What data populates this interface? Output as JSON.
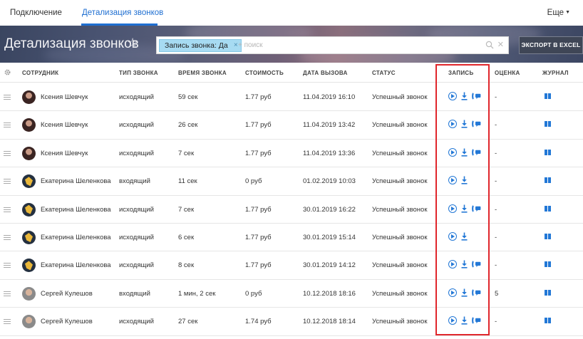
{
  "nav": {
    "tab_connection": "Подключение",
    "tab_details": "Детализация звонков",
    "more": "Еще"
  },
  "banner": {
    "title": "Детализация звонков",
    "chip": "Запись звонка: Да",
    "search_placeholder": "+ поиск",
    "export_label": "ЭКСПОРТ В EXCEL"
  },
  "columns": {
    "employee": "СОТРУДНИК",
    "type": "ТИП ЗВОНКА",
    "time": "ВРЕМЯ ЗВОНКА",
    "cost": "СТОИМОСТЬ",
    "date": "ДАТА ВЫЗОВА",
    "status": "СТАТУС",
    "record": "ЗАПИСЬ",
    "score": "ОЦЕНКА",
    "journal": "ЖУРНАЛ"
  },
  "rows": [
    {
      "name": "Ксения Шевчук",
      "avatar": "k",
      "type": "исходящий",
      "time": "59 сек",
      "cost": "1.77 руб",
      "date": "11.04.2019 16:10",
      "status": "Успешный звонок",
      "call_icon": true,
      "score": "-"
    },
    {
      "name": "Ксения Шевчук",
      "avatar": "k",
      "type": "исходящий",
      "time": "26 сек",
      "cost": "1.77 руб",
      "date": "11.04.2019 13:42",
      "status": "Успешный звонок",
      "call_icon": true,
      "score": "-"
    },
    {
      "name": "Ксения Шевчук",
      "avatar": "k",
      "type": "исходящий",
      "time": "7 сек",
      "cost": "1.77 руб",
      "date": "11.04.2019 13:36",
      "status": "Успешный звонок",
      "call_icon": true,
      "score": "-"
    },
    {
      "name": "Екатерина Шеленкова",
      "avatar": "e",
      "type": "входящий",
      "time": "11 сек",
      "cost": "0 руб",
      "date": "01.02.2019 10:03",
      "status": "Успешный звонок",
      "call_icon": false,
      "score": "-"
    },
    {
      "name": "Екатерина Шеленкова",
      "avatar": "e",
      "type": "исходящий",
      "time": "7 сек",
      "cost": "1.77 руб",
      "date": "30.01.2019 16:22",
      "status": "Успешный звонок",
      "call_icon": true,
      "score": "-"
    },
    {
      "name": "Екатерина Шеленкова",
      "avatar": "e",
      "type": "исходящий",
      "time": "6 сек",
      "cost": "1.77 руб",
      "date": "30.01.2019 15:14",
      "status": "Успешный звонок",
      "call_icon": false,
      "score": "-"
    },
    {
      "name": "Екатерина Шеленкова",
      "avatar": "e",
      "type": "исходящий",
      "time": "8 сек",
      "cost": "1.77 руб",
      "date": "30.01.2019 14:12",
      "status": "Успешный звонок",
      "call_icon": true,
      "score": "-"
    },
    {
      "name": "Сергей Кулешов",
      "avatar": "s",
      "type": "входящий",
      "time": "1 мин, 2 сек",
      "cost": "0 руб",
      "date": "10.12.2018 18:16",
      "status": "Успешный звонок",
      "call_icon": true,
      "score": "5"
    },
    {
      "name": "Сергей Кулешов",
      "avatar": "s",
      "type": "исходящий",
      "time": "27 сек",
      "cost": "1.74 руб",
      "date": "10.12.2018 18:14",
      "status": "Успешный звонок",
      "call_icon": true,
      "score": "-"
    }
  ],
  "colors": {
    "accent": "#2378d6",
    "highlight_box": "#e0262b",
    "chip": "#a7dbf2"
  }
}
